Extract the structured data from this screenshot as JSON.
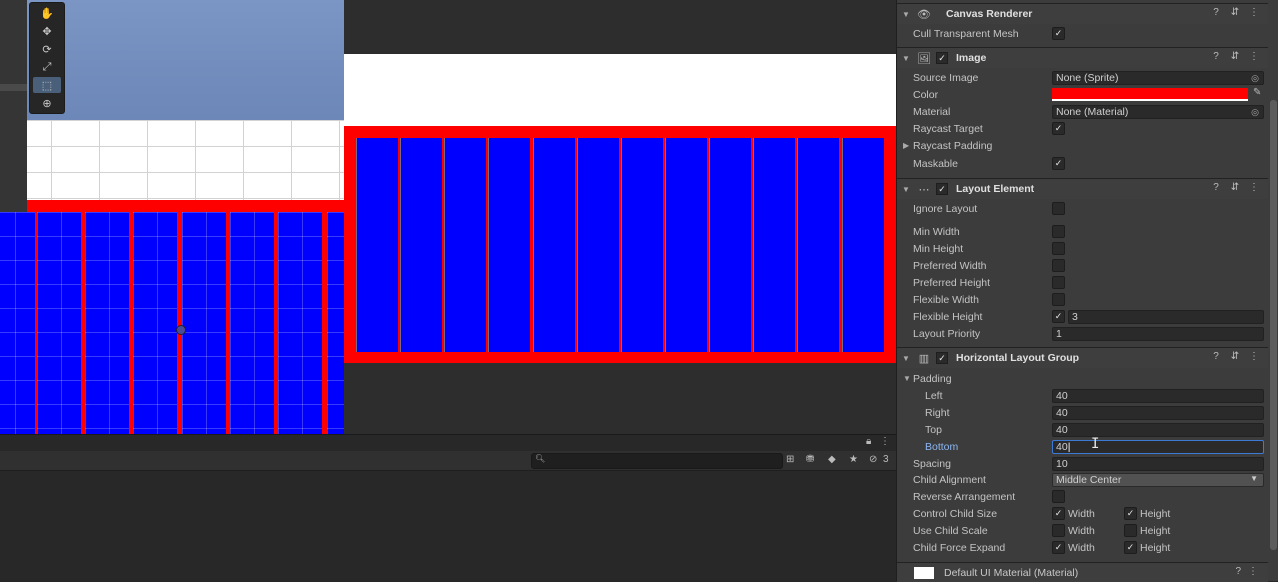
{
  "colors": {
    "red": "#ff0000",
    "blue": "#0000ff",
    "white": "#ffffff",
    "accent": "#3d7ad6"
  },
  "scene": {
    "tools": [
      "hand-tool",
      "move-tool",
      "rotate-tool",
      "scale-tool",
      "rect-tool",
      "transform-tool"
    ],
    "tool_glyphs": [
      "✋",
      "✥",
      "⟳",
      "⤢",
      "⬚",
      "⊕"
    ],
    "active_tool": "rect-tool"
  },
  "bottom": {
    "hidden_count": "3"
  },
  "inspector": {
    "canvas_renderer": {
      "title": "Canvas Renderer",
      "cull_label": "Cull Transparent Mesh",
      "cull_checked": "✓"
    },
    "image": {
      "title": "Image",
      "source_label": "Source Image",
      "source_value": "None (Sprite)",
      "color_label": "Color",
      "material_label": "Material",
      "material_value": "None (Material)",
      "raycast_target_label": "Raycast Target",
      "raycast_target_checked": "✓",
      "raycast_padding_label": "Raycast Padding",
      "maskable_label": "Maskable",
      "maskable_checked": "✓"
    },
    "layout_element": {
      "title": "Layout Element",
      "ignore_label": "Ignore Layout",
      "min_width_label": "Min Width",
      "min_height_label": "Min Height",
      "pref_width_label": "Preferred Width",
      "pref_height_label": "Preferred Height",
      "flex_width_label": "Flexible Width",
      "flex_height_label": "Flexible Height",
      "flex_height_checked": "✓",
      "flex_height_value": "3",
      "priority_label": "Layout Priority",
      "priority_value": "1"
    },
    "hlg": {
      "title": "Horizontal Layout Group",
      "padding_label": "Padding",
      "left_label": "Left",
      "left_value": "40",
      "right_label": "Right",
      "right_value": "40",
      "top_label": "Top",
      "top_value": "40",
      "bottom_label": "Bottom",
      "bottom_value": "40",
      "spacing_label": "Spacing",
      "spacing_value": "10",
      "alignment_label": "Child Alignment",
      "alignment_value": "Middle Center",
      "reverse_label": "Reverse Arrangement",
      "control_label": "Control Child Size",
      "scale_label": "Use Child Scale",
      "expand_label": "Child Force Expand",
      "width_label": "Width",
      "height_label": "Height",
      "check": "✓"
    },
    "footer_title": "Default UI Material (Material)"
  }
}
